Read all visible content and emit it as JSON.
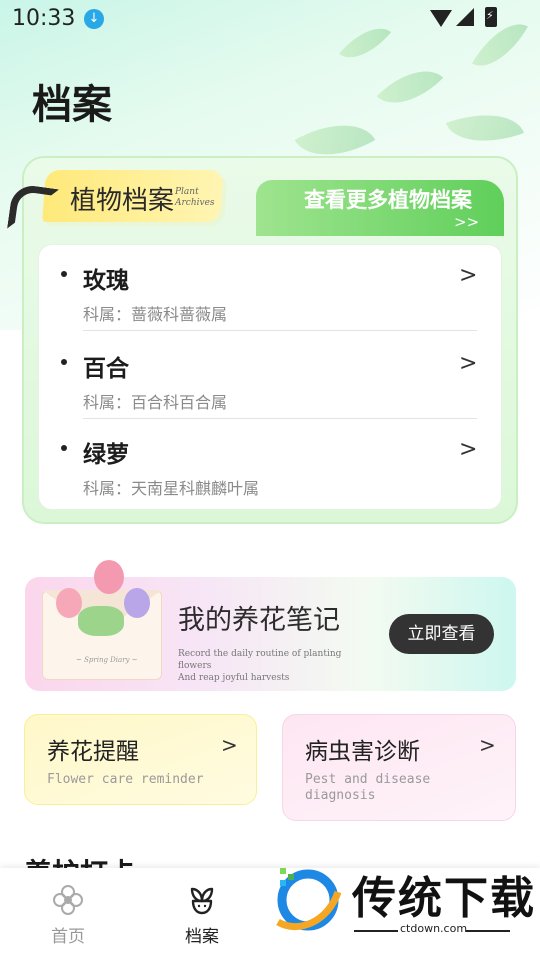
{
  "status_bar": {
    "time": "10:33"
  },
  "page_title": "档案",
  "archive": {
    "tag_label": "植物档案",
    "tag_en_line1": "Plant",
    "tag_en_line2": "Archives",
    "more_label": "查看更多植物档案",
    "more_arrows": ">>",
    "plants": [
      {
        "name": "玫瑰",
        "family": "科属：蔷薇科蔷薇属"
      },
      {
        "name": "百合",
        "family": "科属：百合科百合属"
      },
      {
        "name": "绿萝",
        "family": "科属：天南星科麒麟叶属"
      }
    ]
  },
  "notes": {
    "title": "我的养花笔记",
    "subtitle_line1": "Record the daily routine of planting flowers",
    "subtitle_line2": "And reap joyful harvests",
    "envelope_caption": "~ Spring Diary ~",
    "button_label": "立即查看"
  },
  "features": {
    "care": {
      "title": "养花提醒",
      "subtitle": "Flower care reminder"
    },
    "pest": {
      "title": "病虫害诊断",
      "subtitle": "Pest and disease diagnosis"
    }
  },
  "section_title": "养护打卡",
  "bottom_nav": {
    "home_label": "首页",
    "archive_label": "档案"
  },
  "watermark": {
    "text": "传统下载",
    "url": "ctdown.com"
  },
  "colors": {
    "accent_green": "#5fcf5a",
    "tag_yellow": "#ffe97a",
    "button_dark": "#333333"
  }
}
